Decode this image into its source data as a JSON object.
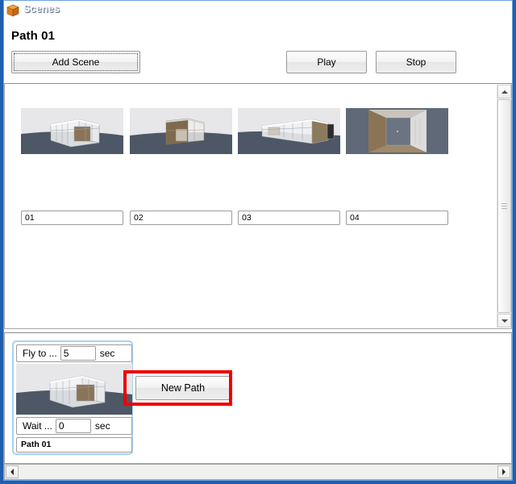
{
  "window": {
    "title": "Scenes",
    "icon": "cube-icon",
    "controls": {
      "minimize": "minimize-icon",
      "maximize": "maximize-icon",
      "close": "close-icon"
    }
  },
  "header": {
    "path_title": "Path 01",
    "add_scene_label": "Add Scene",
    "play_label": "Play",
    "stop_label": "Stop"
  },
  "scenes": {
    "items": [
      {
        "name": "01",
        "thumb": "exterior-glass-pavilion-left"
      },
      {
        "name": "02",
        "thumb": "exterior-brown-box-front"
      },
      {
        "name": "03",
        "thumb": "exterior-long-glass-right"
      },
      {
        "name": "04",
        "thumb": "interior-box-view"
      }
    ]
  },
  "paths": {
    "items": [
      {
        "fly_label": "Fly to ...",
        "fly_value": "5",
        "fly_unit": "sec",
        "thumb": "exterior-glass-pavilion-left",
        "wait_label": "Wait ...",
        "wait_value": "0",
        "wait_unit": "sec",
        "name": "Path 01",
        "selected": true
      }
    ],
    "new_path_label": "New Path"
  },
  "annotation": {
    "highlight_color": "#ee0000",
    "highlight_target": "New Path"
  },
  "scrollbars": {
    "vertical": {
      "up": "scroll-up-icon",
      "down": "scroll-down-icon"
    },
    "horizontal": {
      "left": "scroll-left-icon",
      "right": "scroll-right-icon"
    }
  }
}
